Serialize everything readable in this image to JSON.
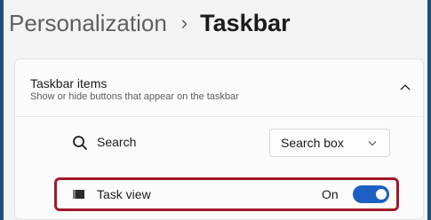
{
  "breadcrumb": {
    "parent": "Personalization",
    "separator": "›",
    "current": "Taskbar"
  },
  "section": {
    "title": "Taskbar items",
    "description": "Show or hide buttons that appear on the taskbar",
    "expand_icon": "chevron-up-icon"
  },
  "items": {
    "search": {
      "label": "Search",
      "icon": "search-icon",
      "dropdown_value": "Search box",
      "dropdown_icon": "chevron-down-icon"
    },
    "task_view": {
      "label": "Task view",
      "icon": "task-view-icon",
      "toggle_state": "On",
      "toggle_on": true
    }
  },
  "colors": {
    "accent": "#1d5fc2",
    "highlight_border": "#a01a2a",
    "frame_border": "#1f4e79",
    "background": "#f3f3f3"
  }
}
